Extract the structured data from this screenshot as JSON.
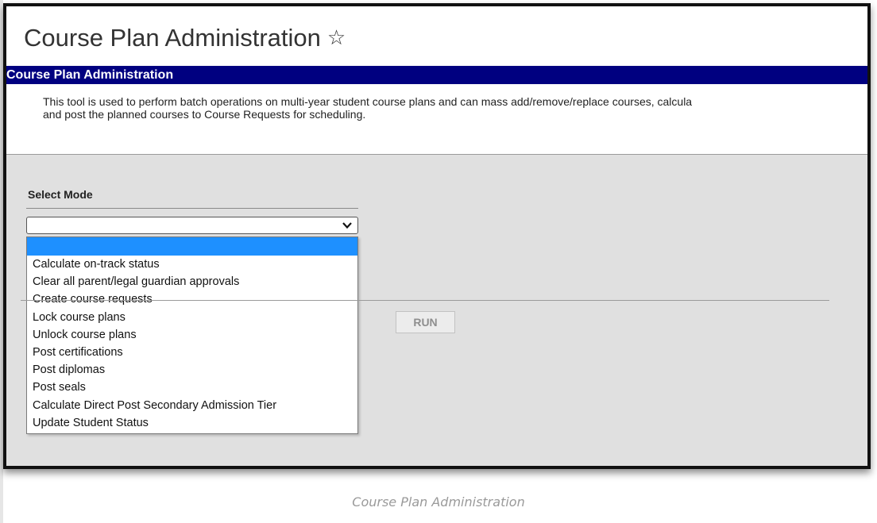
{
  "page": {
    "title": "Course Plan Administration",
    "star_glyph": "☆"
  },
  "section": {
    "header": "Course Plan Administration",
    "description_line1": "This tool is used to perform batch operations on multi-year student course plans and can mass add/remove/replace courses, calcula",
    "description_line2": "and post the planned courses to Course Requests for scheduling."
  },
  "mode": {
    "label": "Select Mode",
    "selected_value": "",
    "options": [
      "",
      "Calculate on-track status",
      "Clear all parent/legal guardian approvals",
      "Create course requests",
      "Lock course plans",
      "Unlock course plans",
      "Post certifications",
      "Post diplomas",
      "Post seals",
      "Calculate Direct Post Secondary Admission Tier",
      "Update Student Status"
    ]
  },
  "run_button": {
    "label": "RUN"
  },
  "caption": "Course Plan Administration",
  "colors": {
    "header_bg": "#000080",
    "selected_option_bg": "#1e90ff",
    "panel_bg": "#e0e0e0"
  }
}
